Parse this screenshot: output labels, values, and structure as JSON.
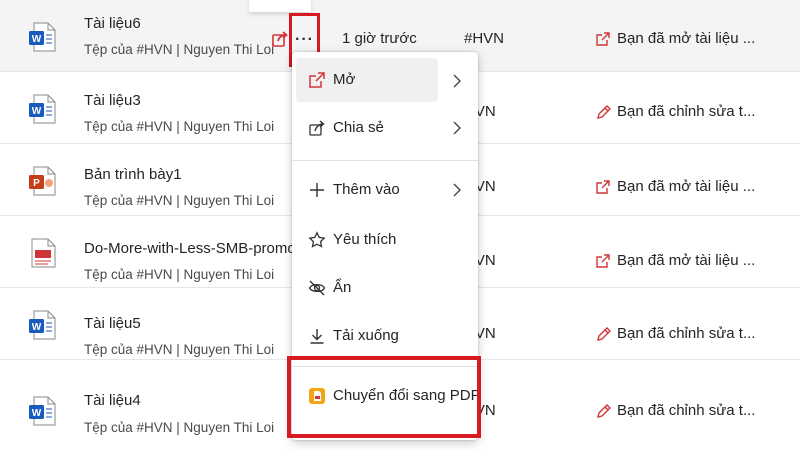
{
  "files": [
    {
      "name": "Tài liệu6",
      "owner": "Tệp của #HVN | Nguyen Thi Loi",
      "time": "1 giờ trước",
      "tag": "#HVN",
      "activity": "Bạn đã mở tài liệu ...",
      "type": "word",
      "activity_icon": "open-icon"
    },
    {
      "name": "Tài liệu3",
      "owner": "Tệp của #HVN | Nguyen Thi Loi",
      "time": "",
      "tag": "HVN",
      "activity": "Bạn đã chỉnh sửa t...",
      "type": "word",
      "activity_icon": "pencil-icon"
    },
    {
      "name": "Bản trình bày1",
      "owner": "Tệp của #HVN | Nguyen Thi Loi",
      "time": "",
      "tag": "HVN",
      "activity": "Bạn đã mở tài liệu ...",
      "type": "powerpoint",
      "activity_icon": "open-icon"
    },
    {
      "name": "Do-More-with-Less-SMB-promo-...",
      "owner": "Tệp của #HVN | Nguyen Thi Loi",
      "time": "",
      "tag": "HVN",
      "activity": "Bạn đã mở tài liệu ...",
      "type": "pdf",
      "activity_icon": "open-icon"
    },
    {
      "name": "Tài liệu5",
      "owner": "Tệp của #HVN | Nguyen Thi Loi",
      "time": "",
      "tag": "HVN",
      "activity": "Bạn đã chỉnh sửa t...",
      "type": "word",
      "activity_icon": "pencil-icon"
    },
    {
      "name": "Tài liệu4",
      "owner": "Tệp của #HVN | Nguyen Thi Loi",
      "time": "",
      "tag": "HVN",
      "activity": "Bạn đã chỉnh sửa t...",
      "type": "word",
      "activity_icon": "pencil-icon"
    }
  ],
  "more_button": {
    "label": "···"
  },
  "context_menu": {
    "items": [
      {
        "label": "Mở",
        "icon": "open-icon",
        "has_submenu": true
      },
      {
        "label": "Chia sẻ",
        "icon": "share-icon",
        "has_submenu": true
      },
      {
        "label": "Thêm vào",
        "icon": "plus-icon",
        "has_submenu": true
      },
      {
        "label": "Yêu thích",
        "icon": "star-icon",
        "has_submenu": false
      },
      {
        "label": "Ẩn",
        "icon": "hide-icon",
        "has_submenu": false
      },
      {
        "label": "Tải xuống",
        "icon": "download-icon",
        "has_submenu": false
      },
      {
        "label": "Chuyển đổi sang PDF",
        "icon": "pdf-convert-icon",
        "has_submenu": false
      }
    ]
  },
  "colors": {
    "highlight": "#d71a21",
    "word_blue": "#185abd",
    "ppt_orange": "#c43e1c",
    "accent_red": "#d13438"
  }
}
